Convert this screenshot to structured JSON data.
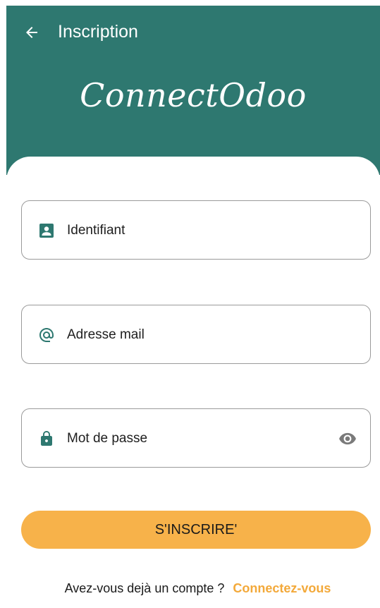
{
  "header": {
    "title": "Inscription",
    "brand": "ConnectOdoo",
    "back_icon": "arrow-left-icon",
    "background_color": "#2e7870"
  },
  "form": {
    "username": {
      "placeholder": "Identifiant",
      "icon": "badge-icon"
    },
    "email": {
      "placeholder": "Adresse mail",
      "icon": "at-sign-icon"
    },
    "password": {
      "placeholder": "Mot de passe",
      "icon": "lock-icon",
      "trailing_icon": "eye-icon"
    },
    "submit_label": "S'INSCRIRE'",
    "button_color": "#f7b24a"
  },
  "footer": {
    "question": "Avez-vous dejà un compte ?",
    "link_label": "Connectez-vous",
    "link_color": "#f3a93a"
  }
}
